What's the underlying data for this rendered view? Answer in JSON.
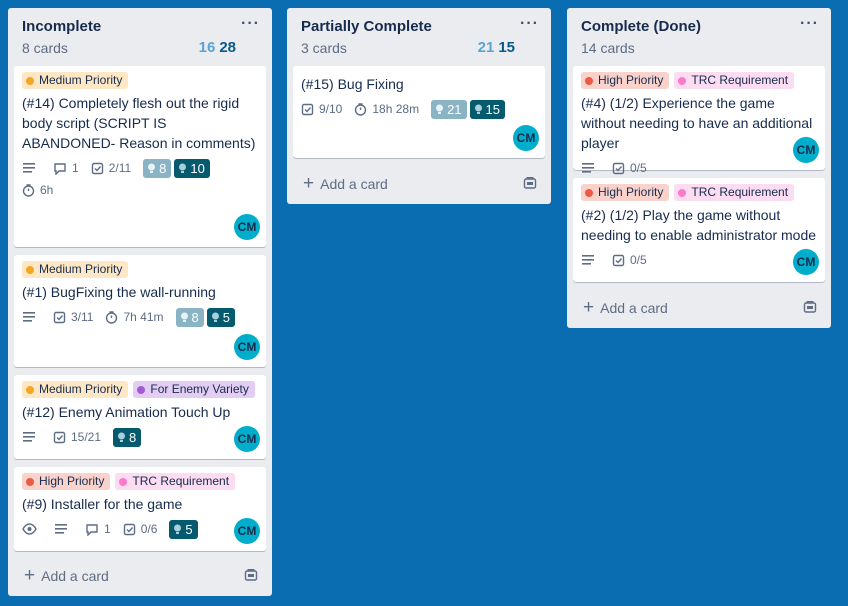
{
  "colors": {
    "board_bg": "#0a6db1",
    "list_bg": "#ebecf0",
    "medium_priority_bg": "#fde7c4",
    "medium_priority_dot": "#f5a623",
    "high_priority_bg": "#f9d2cc",
    "high_priority_dot": "#eb5a46",
    "trc_bg": "#fbdcf0",
    "trc_dot": "#ff78cb",
    "enemy_bg": "#e3cdf2",
    "enemy_dot": "#a35bd4",
    "avatar": "#00aecc",
    "points_light": "#8ab4c4",
    "points_dark": "#055a6e"
  },
  "lists": [
    {
      "title": "Incomplete",
      "count": "8 cards",
      "menu": "···",
      "total_light": "16",
      "total_dark": "28",
      "add_card": "Add a card",
      "cards": [
        {
          "labels": [
            {
              "text": "Medium Priority",
              "type": "medium"
            }
          ],
          "title": "(#14) Completely flesh out the rigid body script (SCRIPT IS ABANDONED- Reason in comments)",
          "has_description": true,
          "comments": "1",
          "checklist": "2/11",
          "points_light": "8",
          "points_dark": "10",
          "time": "6h",
          "avatar": "CM"
        },
        {
          "labels": [
            {
              "text": "Medium Priority",
              "type": "medium"
            }
          ],
          "title": "(#1) BugFixing the wall-running",
          "has_description": true,
          "checklist": "3/11",
          "time": "7h 41m",
          "points_light": "8",
          "points_dark": "5",
          "avatar": "CM"
        },
        {
          "labels": [
            {
              "text": "Medium Priority",
              "type": "medium"
            },
            {
              "text": "For Enemy Variety",
              "type": "enemy"
            }
          ],
          "title": "(#12) Enemy Animation Touch Up",
          "has_description": true,
          "checklist": "15/21",
          "points_dark": "8",
          "avatar": "CM"
        },
        {
          "labels": [
            {
              "text": "High Priority",
              "type": "high"
            },
            {
              "text": "TRC Requirement",
              "type": "trc"
            }
          ],
          "title": "(#9) Installer for the game",
          "watching": true,
          "has_description": true,
          "comments": "1",
          "checklist": "0/6",
          "points_dark": "5",
          "avatar": "CM"
        }
      ]
    },
    {
      "title": "Partially Complete",
      "count": "3 cards",
      "menu": "···",
      "total_light": "21",
      "total_dark": "15",
      "add_card": "Add a card",
      "cards": [
        {
          "labels": [],
          "title": "(#15) Bug Fixing",
          "checklist": "9/10",
          "time": "18h 28m",
          "points_light": "21",
          "points_dark": "15",
          "avatar": "CM"
        }
      ]
    },
    {
      "title": "Complete (Done)",
      "count": "14 cards",
      "menu": "···",
      "add_card": "Add a card",
      "cards": [
        {
          "labels": [
            {
              "text": "High Priority",
              "type": "high"
            },
            {
              "text": "TRC Requirement",
              "type": "trc"
            }
          ],
          "title": "(#4) (1/2) Experience the game without needing to have an additional player",
          "has_description": true,
          "checklist": "0/5",
          "avatar": "CM"
        },
        {
          "labels": [
            {
              "text": "High Priority",
              "type": "high"
            },
            {
              "text": "TRC Requirement",
              "type": "trc"
            }
          ],
          "title": "(#2) (1/2) Play the game without needing to enable administrator mode",
          "has_description": true,
          "checklist": "0/5",
          "avatar": "CM"
        }
      ]
    }
  ]
}
